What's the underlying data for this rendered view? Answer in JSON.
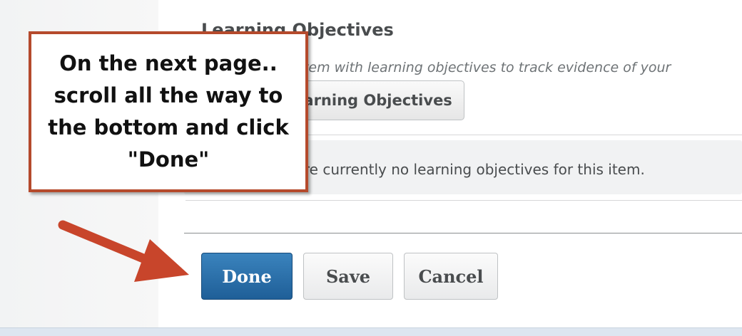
{
  "section": {
    "title": "Learning Objectives",
    "description": "Associate this item with learning objectives to track evidence of your",
    "manage_button": "Manage Learning Objectives"
  },
  "empty_state": {
    "text": "There are currently no learning objectives for this item."
  },
  "actions": {
    "done": "Done",
    "save": "Save",
    "cancel": "Cancel"
  },
  "callout": {
    "text": "On the next page.. scroll all the way to the bottom and click \"Done\""
  },
  "colors": {
    "primary_button": "#2a6eab",
    "annotation": "#b54a2c",
    "arrow": "#c8452b"
  },
  "icons": {
    "annotation_arrow": "arrow-icon"
  }
}
